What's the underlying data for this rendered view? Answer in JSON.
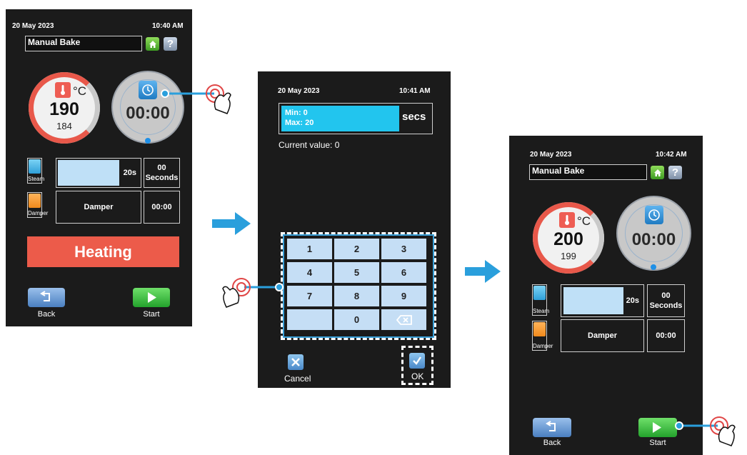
{
  "screen1": {
    "date": "20 May 2023",
    "time": "10:40 AM",
    "title": "Manual Bake",
    "help": "?",
    "temp_unit": "°C",
    "temp_set": "190",
    "temp_actual": "184",
    "timer": "00:00",
    "steam_label": "Steam",
    "steam_value": "20s",
    "seconds_value": "00",
    "seconds_label": "Seconds",
    "damper_label": "Damper",
    "damper_box": "Damper",
    "damper_time": "00:00",
    "status": "Heating",
    "back": "Back",
    "start": "Start"
  },
  "screen2": {
    "date": "20 May 2023",
    "time": "10:41 AM",
    "min": "Min: 0",
    "max": "Max: 20",
    "unit": "secs",
    "current": "Current value: 0",
    "keys": [
      "1",
      "2",
      "3",
      "4",
      "5",
      "6",
      "7",
      "8",
      "9",
      "",
      "0"
    ],
    "cancel": "Cancel",
    "ok": "OK"
  },
  "screen3": {
    "date": "20 May 2023",
    "time": "10:42 AM",
    "title": "Manual Bake",
    "help": "?",
    "temp_unit": "°C",
    "temp_set": "200",
    "temp_actual": "199",
    "timer": "00:00",
    "steam_label": "Steam",
    "steam_value": "20s",
    "seconds_value": "00",
    "seconds_label": "Seconds",
    "damper_label": "Damper",
    "damper_box": "Damper",
    "damper_time": "00:00",
    "back": "Back",
    "start": "Start"
  },
  "colors": {
    "screen_bg": "#1b1b1b",
    "accent_red": "#ec5b4a",
    "accent_blue": "#22c5ee",
    "key_blue": "#c5def5",
    "start_green": "#3cc24a",
    "arrow_blue": "#2a9fdc"
  }
}
